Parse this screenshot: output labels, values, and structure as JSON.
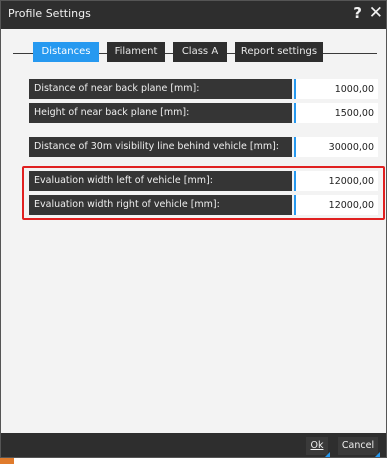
{
  "window": {
    "title": "Profile Settings",
    "help_label": "?",
    "close_label": "✕"
  },
  "tabs": [
    {
      "label": "Distances",
      "active": true
    },
    {
      "label": "Filament",
      "active": false
    },
    {
      "label": "Class A",
      "active": false
    },
    {
      "label": "Report settings",
      "active": false
    }
  ],
  "fields": [
    {
      "label": "Distance of near back plane [mm]:",
      "value": "1000,00"
    },
    {
      "label": "Height of near back plane [mm]:",
      "value": "1500,00"
    },
    {
      "label": "Distance of 30m visibility line behind vehicle [mm]:",
      "value": "30000,00"
    },
    {
      "label": "Evaluation width left of vehicle [mm]:",
      "value": "12000,00"
    },
    {
      "label": "Evaluation width right of vehicle [mm]:",
      "value": "12000,00"
    }
  ],
  "buttons": {
    "ok_label": "Ok",
    "cancel_label": "Cancel"
  },
  "colors": {
    "accent": "#2699f0",
    "highlight": "#e02020",
    "panel": "#353535"
  }
}
